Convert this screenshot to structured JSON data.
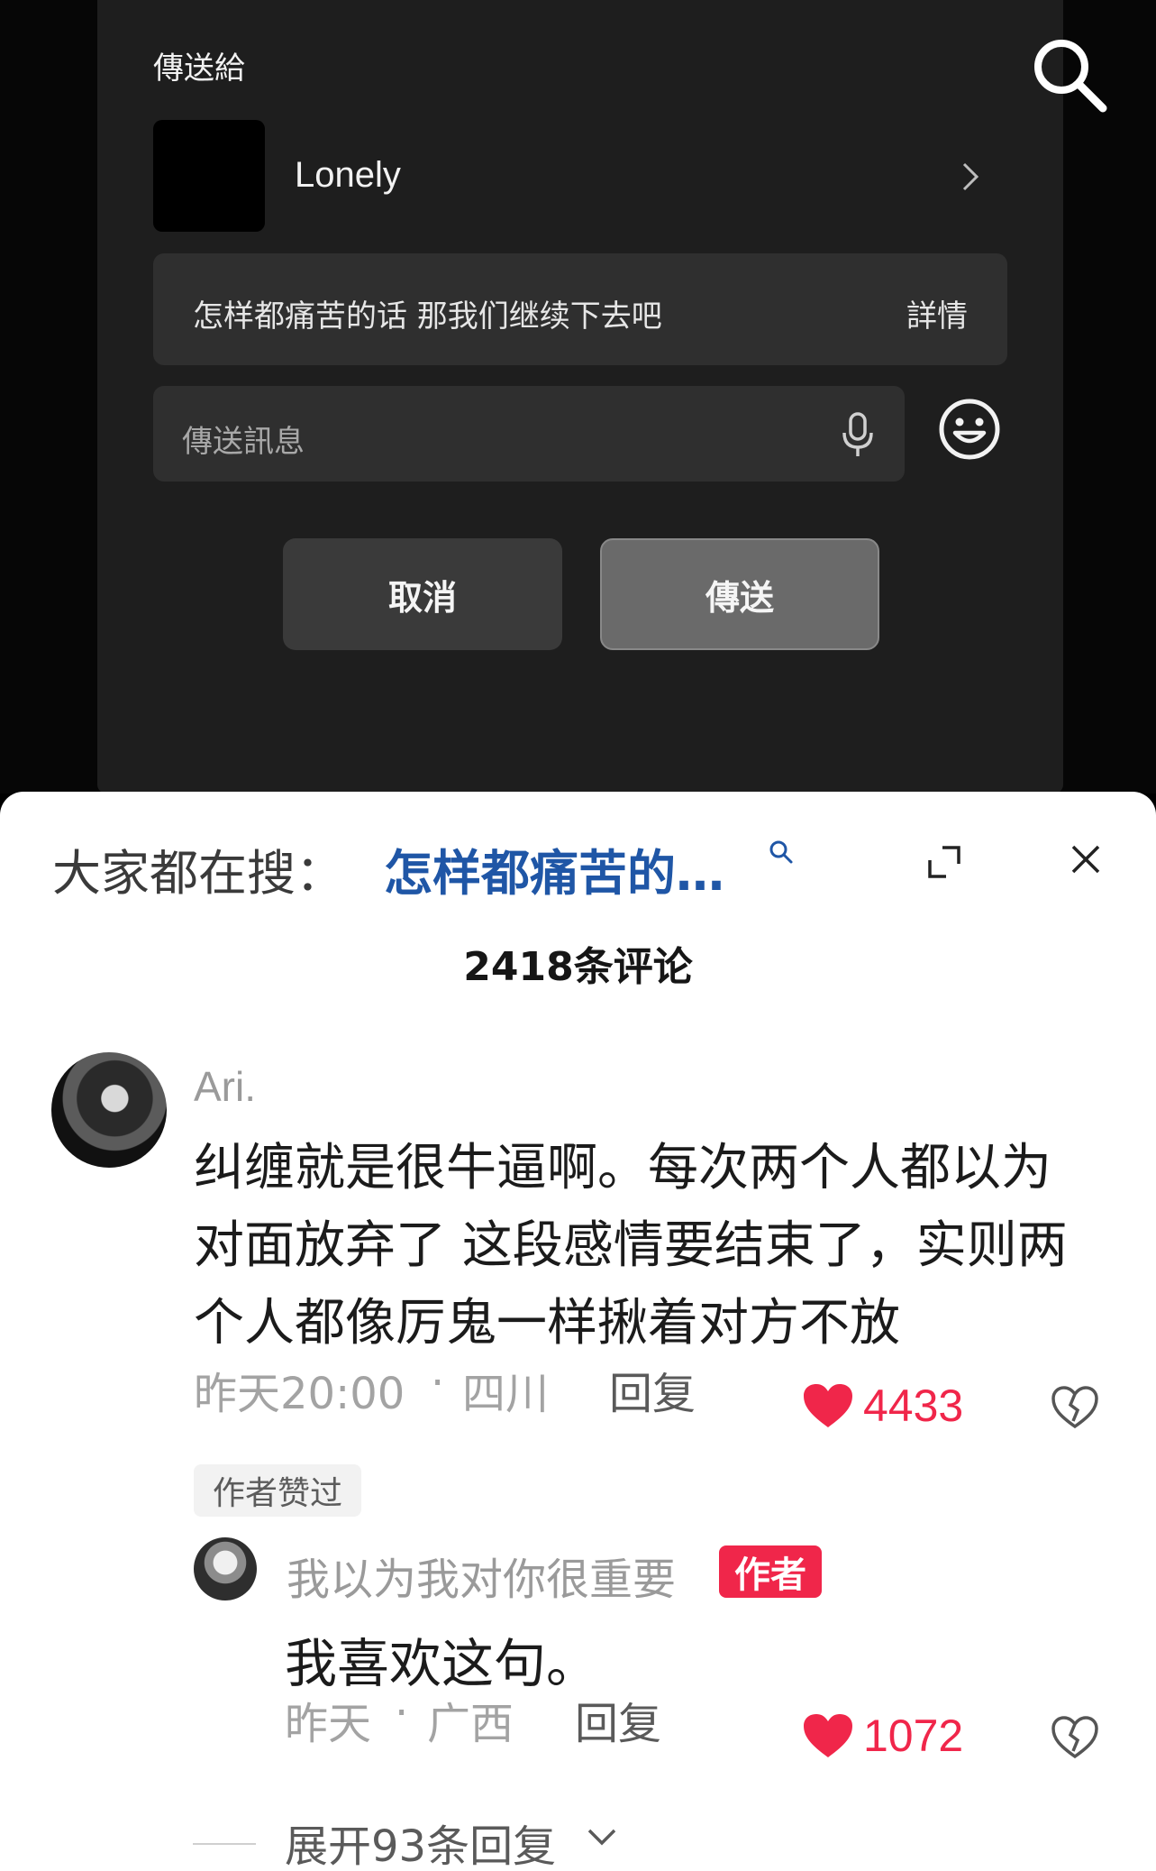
{
  "share_dialog": {
    "title": "傳送給",
    "contact": {
      "name": "Lonely"
    },
    "shared_item": {
      "text": "怎样都痛苦的话 那我们继续下去吧",
      "details_label": "詳情"
    },
    "message_input": {
      "placeholder": "傳送訊息"
    },
    "cancel_label": "取消",
    "send_label": "傳送"
  },
  "comment_sheet": {
    "trending": {
      "prefix": "大家都在搜：",
      "query": "怎样都痛苦的…"
    },
    "comment_count": "2418条评论",
    "comment": {
      "username": "Ari.",
      "text": "纠缠就是很牛逼啊。每次两个人都以为对面放弃了 这段感情要结束了，实则两个人都像厉鬼一样揪着对方不放",
      "time": "昨天20:00",
      "separator": "·",
      "location": "四川",
      "reply_label": "回复",
      "likes": "4433",
      "author_liked_tag": "作者赞过"
    },
    "reply": {
      "username": "我以为我对你很重要",
      "author_badge": "作者",
      "text": "我喜欢这句。",
      "time": "昨天",
      "separator": "·",
      "location": "广西",
      "reply_label": "回复",
      "likes": "1072"
    },
    "expand_replies_label": "展开93条回复"
  },
  "colors": {
    "like_red": "#f0264a",
    "trend_blue": "#1f56a6",
    "author_badge": "#f0264a"
  }
}
